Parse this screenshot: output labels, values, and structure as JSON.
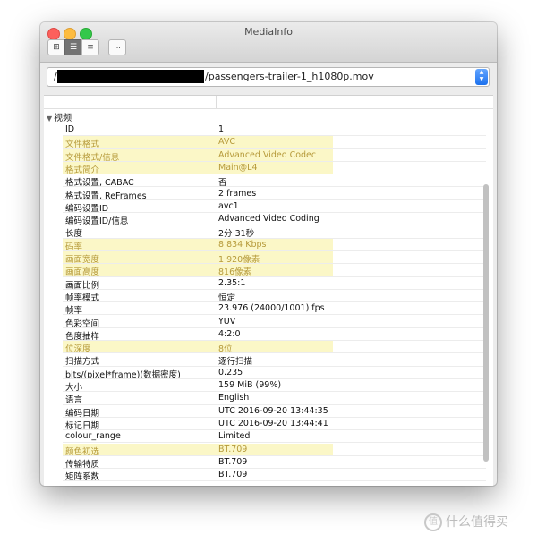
{
  "window": {
    "title": "MediaInfo"
  },
  "toolbar": {
    "more_label": "..."
  },
  "file": {
    "prefix": "/",
    "name": "/passengers-trailer-1_h1080p.mov"
  },
  "section": {
    "label": "视频"
  },
  "rows": [
    {
      "key": "ID",
      "value": "1",
      "hl": false
    },
    {
      "key": "文件格式",
      "value": "AVC",
      "hl": true
    },
    {
      "key": "文件格式/信息",
      "value": "Advanced Video Codec",
      "hl": true
    },
    {
      "key": "格式简介",
      "value": "Main@L4",
      "hl": true
    },
    {
      "key": "格式设置, CABAC",
      "value": "否",
      "hl": false
    },
    {
      "key": "格式设置, ReFrames",
      "value": "2 frames",
      "hl": false
    },
    {
      "key": "编码设置ID",
      "value": "avc1",
      "hl": false
    },
    {
      "key": "编码设置ID/信息",
      "value": "Advanced Video Coding",
      "hl": false
    },
    {
      "key": "长度",
      "value": "2分 31秒",
      "hl": false
    },
    {
      "key": "码率",
      "value": "8 834 Kbps",
      "hl": true
    },
    {
      "key": "画面宽度",
      "value": "1 920像素",
      "hl": true
    },
    {
      "key": "画面高度",
      "value": "816像素",
      "hl": true
    },
    {
      "key": "画面比例",
      "value": "2.35:1",
      "hl": false
    },
    {
      "key": "帧率模式",
      "value": "恒定",
      "hl": false
    },
    {
      "key": "帧率",
      "value": "23.976 (24000/1001) fps",
      "hl": false
    },
    {
      "key": "色彩空间",
      "value": "YUV",
      "hl": false
    },
    {
      "key": "色度抽样",
      "value": "4:2:0",
      "hl": false
    },
    {
      "key": "位深度",
      "value": "8位",
      "hl": true
    },
    {
      "key": "扫描方式",
      "value": "逐行扫描",
      "hl": false
    },
    {
      "key": "bits/(pixel*frame)(数据密度)",
      "value": "0.235",
      "hl": false
    },
    {
      "key": "大小",
      "value": "159 MiB (99%)",
      "hl": false
    },
    {
      "key": "语言",
      "value": "English",
      "hl": false
    },
    {
      "key": "编码日期",
      "value": "UTC 2016-09-20 13:44:35",
      "hl": false
    },
    {
      "key": "标记日期",
      "value": "UTC 2016-09-20 13:44:41",
      "hl": false
    },
    {
      "key": "colour_range",
      "value": "Limited",
      "hl": false
    },
    {
      "key": "颜色初选",
      "value": "BT.709",
      "hl": true
    },
    {
      "key": "传输特质",
      "value": "BT.709",
      "hl": false
    },
    {
      "key": "矩阵系数",
      "value": "BT.709",
      "hl": false
    }
  ],
  "watermark": {
    "logo": "值",
    "text": "什么值得买"
  }
}
